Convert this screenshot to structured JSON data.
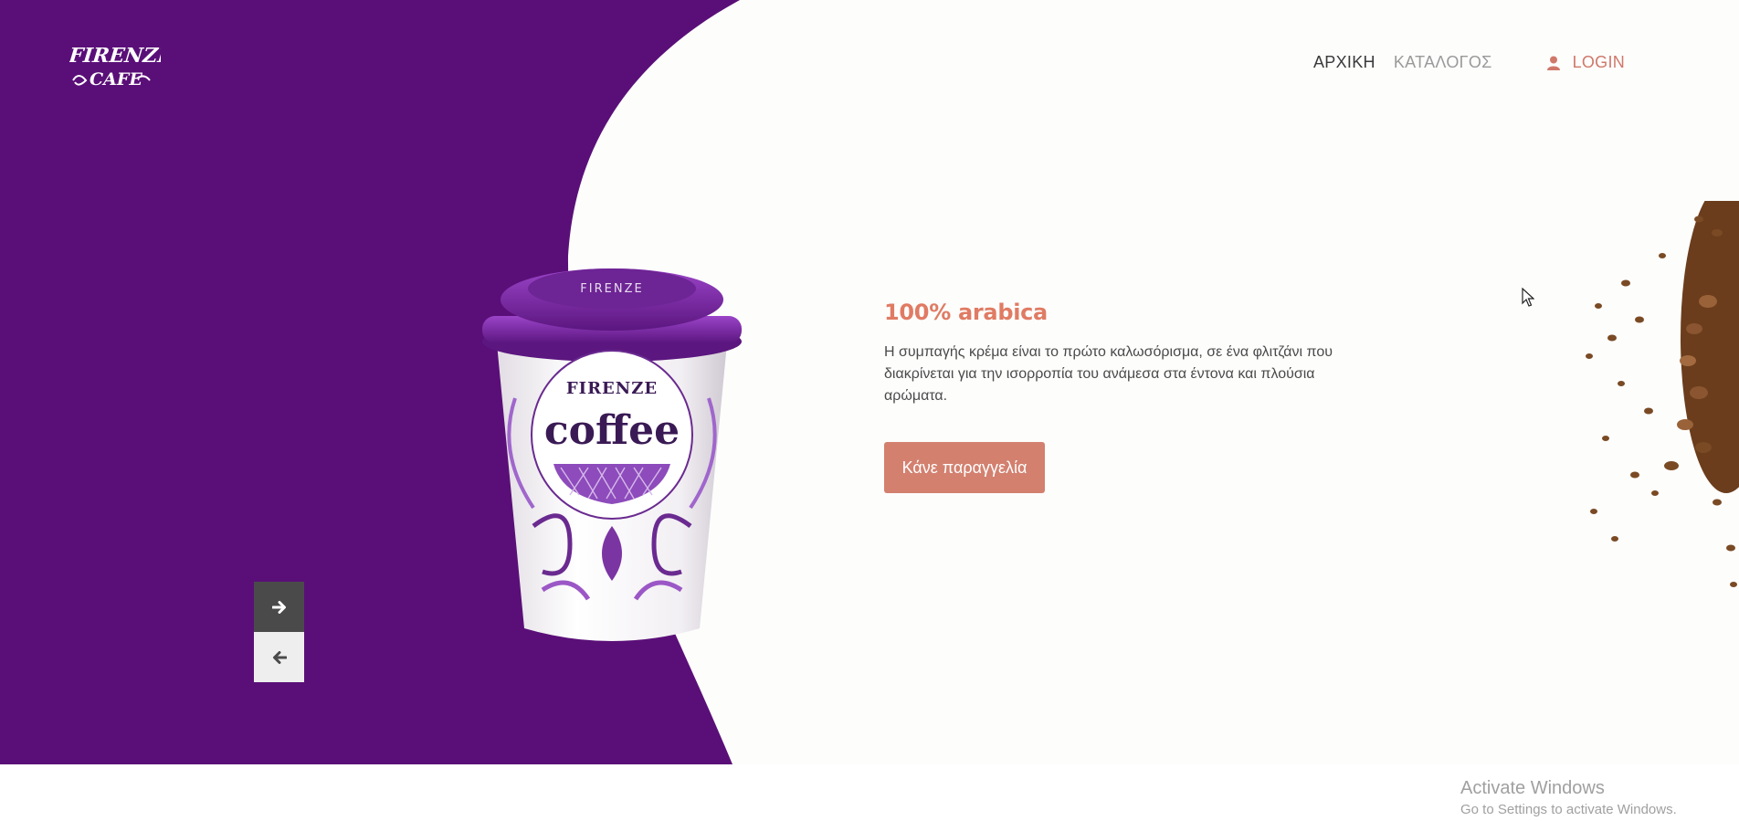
{
  "brand": {
    "logo_line1": "FIRENZE",
    "logo_line2": "CAFE"
  },
  "nav": {
    "items": [
      {
        "label": "ΑΡΧΙΚΗ"
      },
      {
        "label": "ΚΑΤΑΛΟΓΟΣ"
      }
    ],
    "login_label": "LOGIN"
  },
  "hero": {
    "headline": "100% arabica",
    "description": "Η συμπαγής κρέμα είναι το πρώτο καλωσόρισμα, σε ένα φλιτζάνι που διακρίνεται για την ισορροπία του ανάμεσα στα έντονα και πλούσια αρώματα.",
    "cta_label": "Κάνε παραγγελία",
    "product": {
      "cup_brand": "FIRENZE",
      "cup_text": "coffee"
    },
    "slider": {
      "next_icon": "arrow-right-icon",
      "prev_icon": "arrow-left-icon"
    }
  },
  "colors": {
    "purple": "#5a0f78",
    "accent": "#e07b63",
    "button": "#d3806f",
    "nav_active": "#3a3a3a",
    "nav_muted": "#9a9a9a"
  },
  "os_overlay": {
    "title": "Activate Windows",
    "subtitle": "Go to Settings to activate Windows."
  }
}
